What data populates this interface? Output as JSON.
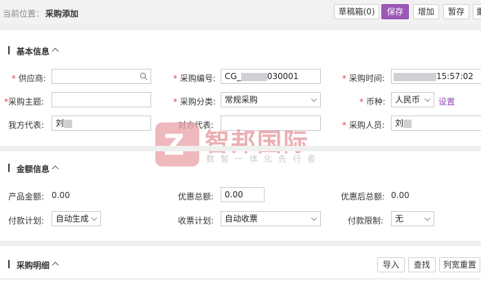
{
  "breadcrumb": {
    "label": "当前位置：",
    "current": "采购添加"
  },
  "toolbar": {
    "draft": "草稿箱(0)",
    "save": "保存",
    "add": "增加",
    "temp_save": "暂存",
    "more": "重"
  },
  "basic_info": {
    "title": "基本信息",
    "supplier_label": "供应商:",
    "purchase_no_label": "采购编号:",
    "purchase_no_value_prefix": "CG_",
    "purchase_no_value_suffix": "030001",
    "purchase_time_label": "采购时间:",
    "purchase_time_value": "15:57:02",
    "subject_label": "采购主题:",
    "category_label": "采购分类:",
    "category_value": "常规采购",
    "currency_label": "币种:",
    "currency_value": "人民币",
    "currency_setting": "设置",
    "our_rep_label": "我方代表:",
    "our_rep_value": "刘",
    "their_rep_label": "对方代表:",
    "purchaser_label": "采购人员:",
    "purchaser_value": "刘"
  },
  "amount_info": {
    "title": "金额信息",
    "product_amount_label": "产品金额:",
    "product_amount_value": "0.00",
    "discount_label": "优惠总额:",
    "discount_value": "0.00",
    "after_discount_label": "优惠后总额:",
    "after_discount_value": "0.00",
    "payment_plan_label": "付款计划:",
    "payment_plan_value": "自动生成",
    "receipt_plan_label": "收票计划:",
    "receipt_plan_value": "自动收票",
    "payment_limit_label": "付款限制:",
    "payment_limit_value": "无"
  },
  "detail": {
    "title": "采购明细",
    "import": "导入",
    "search": "查找",
    "reset_width": "列宽重置"
  },
  "watermark": {
    "title": "智邦国际",
    "subtitle": "数智一体化先行者",
    "logo_letter": "Z"
  },
  "colors": {
    "primary": "#9b59b6",
    "required": "#e23e3e",
    "band": "#efefef"
  }
}
